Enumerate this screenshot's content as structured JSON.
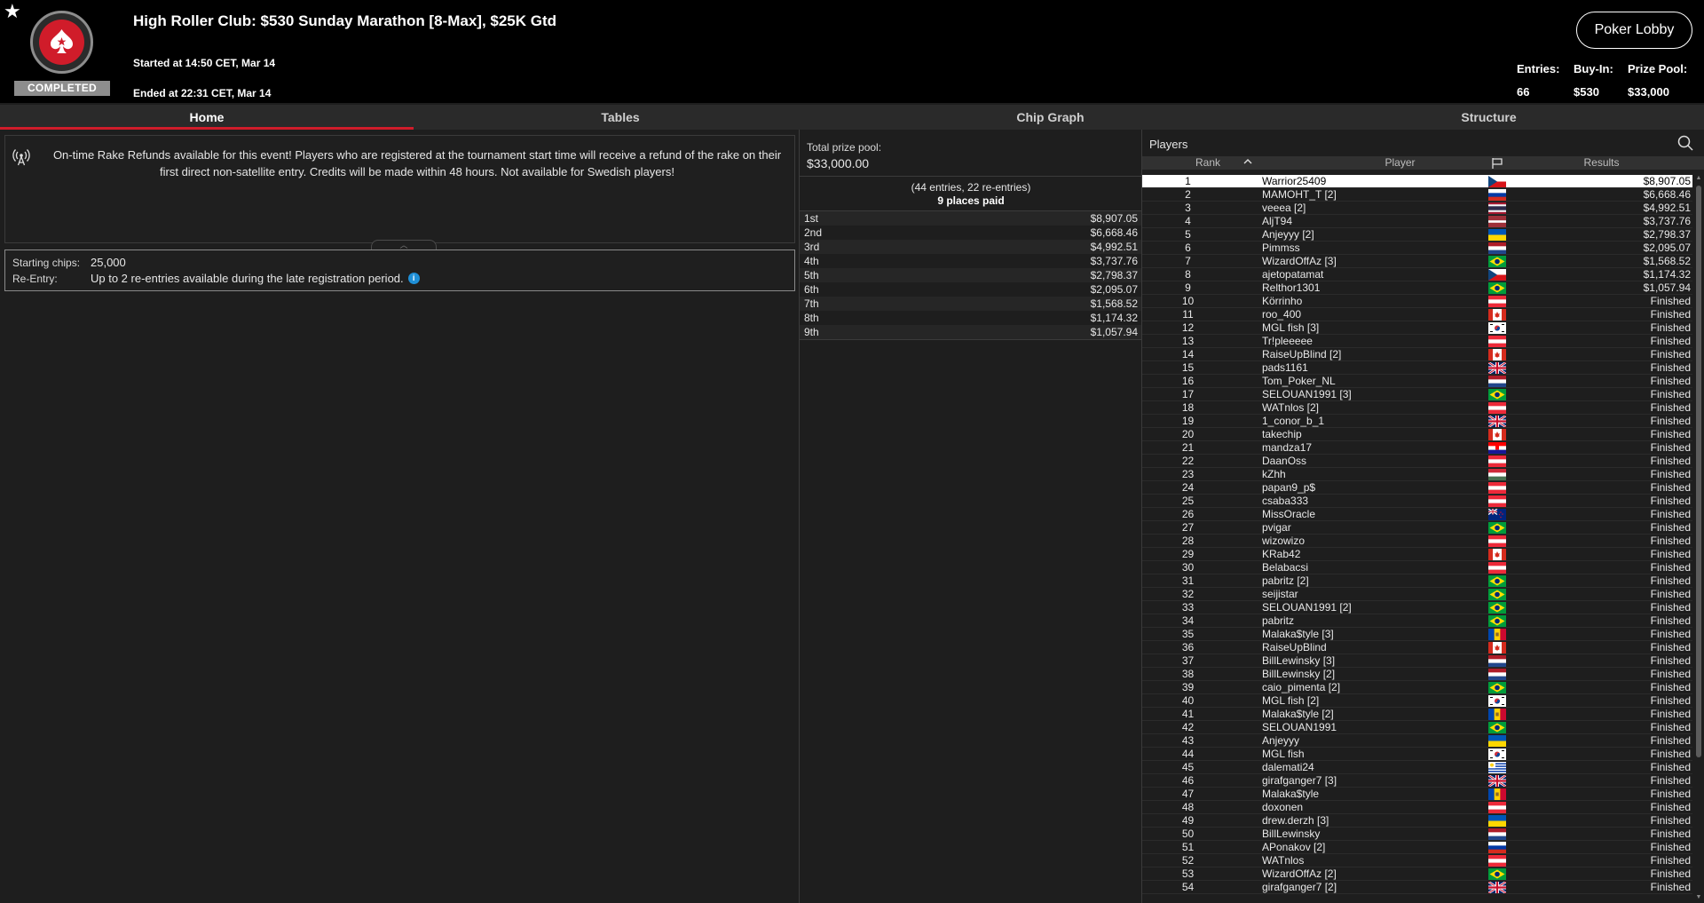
{
  "header": {
    "title": "High Roller Club: $530 Sunday Marathon [8-Max], $25K Gtd",
    "status_badge": "COMPLETED",
    "started": "Started at 14:50 CET, Mar 14",
    "ended": "Ended at 22:31 CET, Mar 14",
    "lobby_button": "Poker Lobby",
    "stats": [
      {
        "label": "Entries:",
        "value": "66"
      },
      {
        "label": "Buy-In:",
        "value": "$530"
      },
      {
        "label": "Prize Pool:",
        "value": "$33,000"
      }
    ]
  },
  "tabs": [
    {
      "label": "Home",
      "active": true
    },
    {
      "label": "Tables",
      "active": false
    },
    {
      "label": "Chip Graph",
      "active": false
    },
    {
      "label": "Structure",
      "active": false
    }
  ],
  "notice": {
    "text": "On-time Rake Refunds available for this event! Players who are registered at the tournament start time will receive a refund of the rake on their first direct non-satellite entry. Credits will be made within 48 hours. Not available for Swedish players!"
  },
  "info": {
    "starting_chips_label": "Starting chips:",
    "starting_chips_value": "25,000",
    "reentry_label": "Re-Entry:",
    "reentry_value": "Up to 2 re-entries available during the late registration period."
  },
  "prizes": {
    "total_label": "Total prize pool:",
    "total_value": "$33,000.00",
    "entries_sub": "(44 entries, 22 re-entries)",
    "places_paid": "9 places paid",
    "payouts": [
      {
        "place": "1st",
        "amount": "$8,907.05"
      },
      {
        "place": "2nd",
        "amount": "$6,668.46"
      },
      {
        "place": "3rd",
        "amount": "$4,992.51"
      },
      {
        "place": "4th",
        "amount": "$3,737.76"
      },
      {
        "place": "5th",
        "amount": "$2,798.37"
      },
      {
        "place": "6th",
        "amount": "$2,095.07"
      },
      {
        "place": "7th",
        "amount": "$1,568.52"
      },
      {
        "place": "8th",
        "amount": "$1,174.32"
      },
      {
        "place": "9th",
        "amount": "$1,057.94"
      }
    ]
  },
  "players": {
    "title": "Players",
    "columns": {
      "rank": "Rank",
      "player": "Player",
      "results": "Results"
    },
    "rows": [
      {
        "rank": "1",
        "player": "Warrior25409",
        "flag": "cz",
        "result": "$8,907.05"
      },
      {
        "rank": "2",
        "player": "MAMOHT_T [2]",
        "flag": "ru",
        "result": "$6,668.46"
      },
      {
        "rank": "3",
        "player": "veeea [2]",
        "flag": "th",
        "result": "$4,992.51"
      },
      {
        "rank": "4",
        "player": "AljT94",
        "flag": "lv",
        "result": "$3,737.76"
      },
      {
        "rank": "5",
        "player": "Anjeyyy [2]",
        "flag": "ua",
        "result": "$2,798.37"
      },
      {
        "rank": "6",
        "player": "Pimmss",
        "flag": "nl",
        "result": "$2,095.07"
      },
      {
        "rank": "7",
        "player": "WizardOffAz [3]",
        "flag": "br",
        "result": "$1,568.52"
      },
      {
        "rank": "8",
        "player": "ajetopatamat",
        "flag": "cz",
        "result": "$1,174.32"
      },
      {
        "rank": "9",
        "player": "Relthor1301",
        "flag": "br",
        "result": "$1,057.94"
      },
      {
        "rank": "10",
        "player": "Körrinho",
        "flag": "at",
        "result": "Finished"
      },
      {
        "rank": "11",
        "player": "roo_400",
        "flag": "ca",
        "result": "Finished"
      },
      {
        "rank": "12",
        "player": "MGL fish [3]",
        "flag": "kr",
        "result": "Finished"
      },
      {
        "rank": "13",
        "player": "Tr!pleeeee",
        "flag": "at",
        "result": "Finished"
      },
      {
        "rank": "14",
        "player": "RaiseUpBlind [2]",
        "flag": "ca",
        "result": "Finished"
      },
      {
        "rank": "15",
        "player": "pads1161",
        "flag": "gb",
        "result": "Finished"
      },
      {
        "rank": "16",
        "player": "Tom_Poker_NL",
        "flag": "nl",
        "result": "Finished"
      },
      {
        "rank": "17",
        "player": "SELOUAN1991 [3]",
        "flag": "br",
        "result": "Finished"
      },
      {
        "rank": "18",
        "player": "WATnlos [2]",
        "flag": "at",
        "result": "Finished"
      },
      {
        "rank": "19",
        "player": "1_conor_b_1",
        "flag": "gb",
        "result": "Finished"
      },
      {
        "rank": "20",
        "player": "takechip",
        "flag": "ca",
        "result": "Finished"
      },
      {
        "rank": "21",
        "player": "mandza17",
        "flag": "hr",
        "result": "Finished"
      },
      {
        "rank": "22",
        "player": "DaanOss",
        "flag": "at",
        "result": "Finished"
      },
      {
        "rank": "23",
        "player": "kZhh",
        "flag": "hu",
        "result": "Finished"
      },
      {
        "rank": "24",
        "player": "papan9_p$",
        "flag": "at",
        "result": "Finished"
      },
      {
        "rank": "25",
        "player": "csaba333",
        "flag": "at",
        "result": "Finished"
      },
      {
        "rank": "26",
        "player": "MissOracle",
        "flag": "nz",
        "result": "Finished"
      },
      {
        "rank": "27",
        "player": "pvigar",
        "flag": "br",
        "result": "Finished"
      },
      {
        "rank": "28",
        "player": "wizowizo",
        "flag": "at",
        "result": "Finished"
      },
      {
        "rank": "29",
        "player": "KRab42",
        "flag": "ca",
        "result": "Finished"
      },
      {
        "rank": "30",
        "player": "Belabacsi",
        "flag": "at",
        "result": "Finished"
      },
      {
        "rank": "31",
        "player": "pabritz [2]",
        "flag": "br",
        "result": "Finished"
      },
      {
        "rank": "32",
        "player": "seijistar",
        "flag": "br",
        "result": "Finished"
      },
      {
        "rank": "33",
        "player": "SELOUAN1991 [2]",
        "flag": "br",
        "result": "Finished"
      },
      {
        "rank": "34",
        "player": "pabritz",
        "flag": "br",
        "result": "Finished"
      },
      {
        "rank": "35",
        "player": "Malaka$tyle [3]",
        "flag": "md",
        "result": "Finished"
      },
      {
        "rank": "36",
        "player": "RaiseUpBlind",
        "flag": "ca",
        "result": "Finished"
      },
      {
        "rank": "37",
        "player": "BillLewinsky [3]",
        "flag": "nl",
        "result": "Finished"
      },
      {
        "rank": "38",
        "player": "BillLewinsky [2]",
        "flag": "nl",
        "result": "Finished"
      },
      {
        "rank": "39",
        "player": "caio_pimenta [2]",
        "flag": "br",
        "result": "Finished"
      },
      {
        "rank": "40",
        "player": "MGL fish [2]",
        "flag": "kr",
        "result": "Finished"
      },
      {
        "rank": "41",
        "player": "Malaka$tyle [2]",
        "flag": "md",
        "result": "Finished"
      },
      {
        "rank": "42",
        "player": "SELOUAN1991",
        "flag": "br",
        "result": "Finished"
      },
      {
        "rank": "43",
        "player": "Anjeyyy",
        "flag": "ua",
        "result": "Finished"
      },
      {
        "rank": "44",
        "player": "MGL fish",
        "flag": "kr",
        "result": "Finished"
      },
      {
        "rank": "45",
        "player": "dalemati24",
        "flag": "uy",
        "result": "Finished"
      },
      {
        "rank": "46",
        "player": "girafganger7 [3]",
        "flag": "gb",
        "result": "Finished"
      },
      {
        "rank": "47",
        "player": "Malaka$tyle",
        "flag": "md",
        "result": "Finished"
      },
      {
        "rank": "48",
        "player": "doxonen",
        "flag": "at",
        "result": "Finished"
      },
      {
        "rank": "49",
        "player": "drew.derzh [3]",
        "flag": "ua",
        "result": "Finished"
      },
      {
        "rank": "50",
        "player": "BillLewinsky",
        "flag": "nl",
        "result": "Finished"
      },
      {
        "rank": "51",
        "player": "APonakov [2]",
        "flag": "ru",
        "result": "Finished"
      },
      {
        "rank": "52",
        "player": "WATnlos",
        "flag": "at",
        "result": "Finished"
      },
      {
        "rank": "53",
        "player": "WizardOffAz [2]",
        "flag": "br",
        "result": "Finished"
      },
      {
        "rank": "54",
        "player": "girafganger7 [2]",
        "flag": "gb",
        "result": "Finished"
      }
    ]
  },
  "colors": {
    "accent_red": "#d01c2a",
    "header_bg": "#000000",
    "panel_bg": "#1e1e1e",
    "info_blue": "#1f8fd6"
  }
}
